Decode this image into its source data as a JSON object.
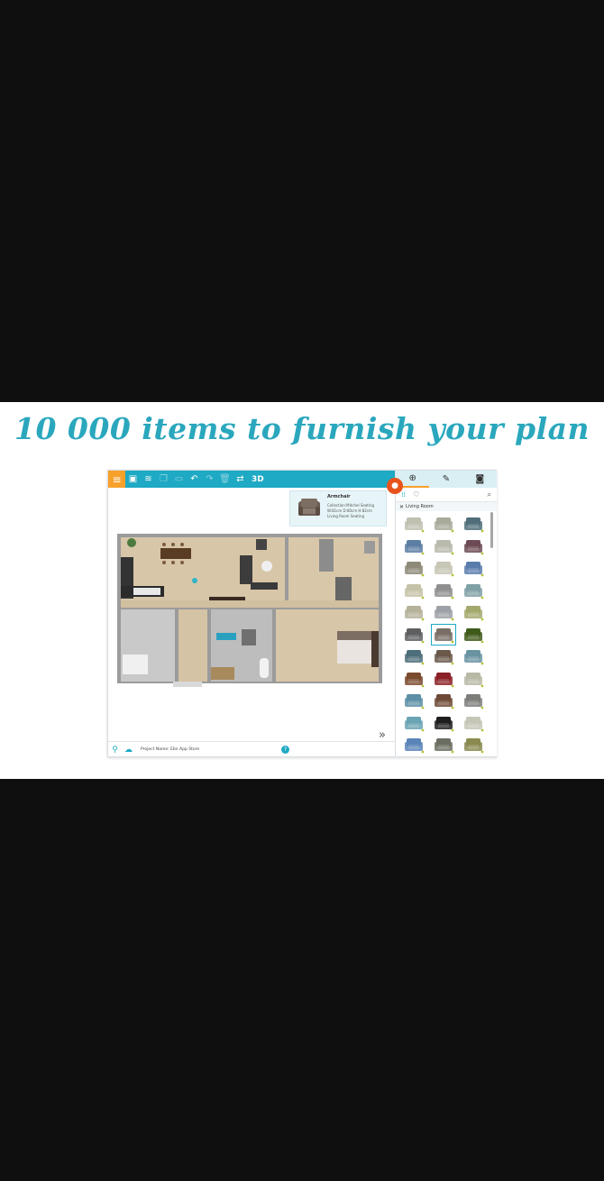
{
  "headline": "10 000 items to furnish your plan",
  "toolbar": {
    "menu_icon": "menu-icon",
    "buttons": [
      "save-icon",
      "layers-icon",
      "copy-icon",
      "paste-icon",
      "undo-icon",
      "redo-icon",
      "delete-icon",
      "flip-icon"
    ],
    "view_3d_label": "3D"
  },
  "record_button_icon": "microphone-icon",
  "info_card": {
    "title": "Armchair",
    "lines": [
      "Collection:Mitchel Seating",
      "W:81cm D:80cm H:82cm",
      "Living Room Seating"
    ]
  },
  "statusbar": {
    "project_label": "Project Name: Ebn App Store",
    "help": "?"
  },
  "side_panel": {
    "tabs": [
      "add-icon",
      "pencil-icon",
      "camera-icon"
    ],
    "filter_label": "Living Room",
    "tools": [
      "grid-icon",
      "heart-icon",
      "search-icon"
    ]
  },
  "colors": {
    "accent": "#1ea9c4",
    "menu": "#f7a12b",
    "record": "#e8531d",
    "headline": "#2aa7bd"
  }
}
